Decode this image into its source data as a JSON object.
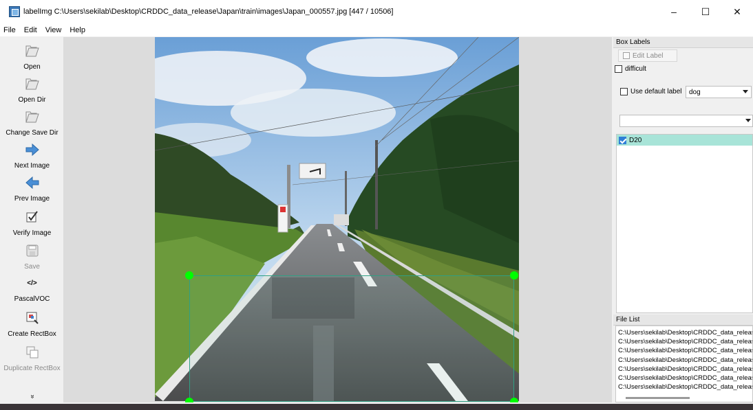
{
  "window": {
    "title": "labelImg C:\\Users\\sekilab\\Desktop\\CRDDC_data_release\\Japan\\train\\images\\Japan_000557.jpg [447 / 10506]",
    "minimize": "–",
    "maximize": "☐",
    "close": "✕"
  },
  "menu": [
    "File",
    "Edit",
    "View",
    "Help"
  ],
  "toolbar": {
    "open": "Open",
    "open_dir": "Open Dir",
    "change_save_dir": "Change Save Dir",
    "next_image": "Next Image",
    "prev_image": "Prev Image",
    "verify_image": "Verify Image",
    "save": "Save",
    "format_icon": "</>",
    "format": "PascalVOC",
    "create_rectbox": "Create RectBox",
    "duplicate_rectbox": "Duplicate RectBox",
    "more": "»"
  },
  "box_labels": {
    "title": "Box Labels",
    "edit_label": "Edit Label",
    "difficult": "difficult",
    "use_default_label": "Use default label",
    "default_label_value": "dog",
    "filter_value": "",
    "labels": [
      "D20"
    ]
  },
  "file_list": {
    "title": "File List",
    "items": [
      "C:\\Users\\sekilab\\Desktop\\CRDDC_data_release",
      "C:\\Users\\sekilab\\Desktop\\CRDDC_data_release",
      "C:\\Users\\sekilab\\Desktop\\CRDDC_data_release",
      "C:\\Users\\sekilab\\Desktop\\CRDDC_data_release",
      "C:\\Users\\sekilab\\Desktop\\CRDDC_data_release",
      "C:\\Users\\sekilab\\Desktop\\CRDDC_data_release",
      "C:\\Users\\sekilab\\Desktop\\CRDDC_data_release"
    ]
  },
  "colors": {
    "label_highlight": "#a8e4d8",
    "handle": "#00ff00",
    "box_border": "#2fa084",
    "next_arrow": "#4a8fd6"
  }
}
